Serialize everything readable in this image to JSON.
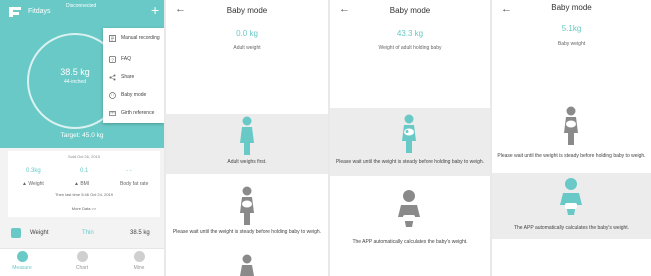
{
  "home": {
    "app_name": "Fitdays",
    "status_text": "Disconnected",
    "plus_symbol": "+",
    "current_weight": "38.5 kg",
    "ring_subtext": "44-inched",
    "target": "Target: 45.0 kg",
    "menu": [
      {
        "icon": "manual-record-icon",
        "label": "Manual recording"
      },
      {
        "icon": "faq-icon",
        "label": "FAQ"
      },
      {
        "icon": "share-icon",
        "label": "Share"
      },
      {
        "icon": "baby-mode-icon",
        "label": "Baby mode"
      },
      {
        "icon": "girth-icon",
        "label": "Girth reference"
      }
    ],
    "card": {
      "date": "Sold Oct 26, 2019",
      "metrics": [
        {
          "value": "0.3kg",
          "label": "▲ Weight"
        },
        {
          "value": "0.1",
          "label": "▲ BMI"
        },
        {
          "value": "- -",
          "label": "Body fat rate"
        }
      ],
      "time": "Then last time 5:46 Oct 24, 2019",
      "more": "More Data >>"
    },
    "weight_row": {
      "label": "Weight",
      "status": "Thin",
      "value": "38.5 kg"
    },
    "tabs": [
      {
        "label": "Measure",
        "active": true
      },
      {
        "label": "Chart",
        "active": false
      },
      {
        "label": "Mine",
        "active": false
      }
    ],
    "accent": "#69c9c6"
  },
  "baby_screens": [
    {
      "back": "←",
      "title": "Baby mode",
      "value": "0.0 kg",
      "subtitle": "Adult weight",
      "step1": "Adult weighs first.",
      "step2": "Please wait until the weight is steady before holding baby to weigh."
    },
    {
      "back": "←",
      "title": "Baby mode",
      "value": "43.3 kg",
      "subtitle": "Weight of adult holding baby",
      "step2": "Please wait until the weight is steady before holding baby to weigh.",
      "step3": "The APP automatically calculates the baby's weight."
    },
    {
      "back": "←",
      "title": "Baby mode",
      "value": "5.1kg",
      "subtitle": "Baby weight",
      "step2": "Please wait until the weight is steady before holding baby to weigh.",
      "step3": "The APP automatically calculates the baby's weight."
    }
  ]
}
